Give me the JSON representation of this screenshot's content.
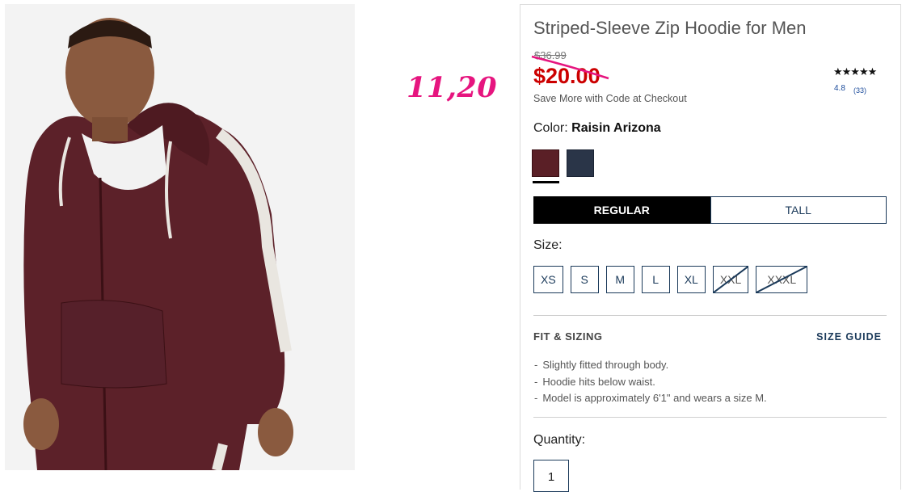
{
  "annotation": {
    "text": "11,20"
  },
  "product": {
    "title": "Striped-Sleeve Zip Hoodie for Men",
    "original_price": "$36.99",
    "sale_price": "$20.00",
    "promo": "Save More with Code at Checkout",
    "rating": {
      "stars": "★★★★★",
      "score": "4.8",
      "count": "(33)"
    }
  },
  "color": {
    "label": "Color:",
    "selected": "Raisin Arizona",
    "swatches": [
      {
        "name": "Raisin Arizona",
        "hex": "#5a1f26",
        "selected": true
      },
      {
        "name": "navy",
        "hex": "#2a3548",
        "selected": false
      }
    ]
  },
  "fit": {
    "options": [
      {
        "label": "REGULAR",
        "active": true
      },
      {
        "label": "TALL",
        "active": false
      }
    ]
  },
  "size": {
    "label": "Size:",
    "options": [
      {
        "label": "XS",
        "available": true
      },
      {
        "label": "S",
        "available": true
      },
      {
        "label": "M",
        "available": true
      },
      {
        "label": "L",
        "available": true
      },
      {
        "label": "XL",
        "available": true
      },
      {
        "label": "XXL",
        "available": false
      },
      {
        "label": "XXXL",
        "available": false
      }
    ]
  },
  "fit_sizing": {
    "heading": "FIT & SIZING",
    "guide_link": "SIZE GUIDE",
    "bullets": [
      "Slightly fitted through body.",
      "Hoodie hits below waist.",
      "Model is approximately 6'1\" and wears a size M."
    ]
  },
  "quantity": {
    "label": "Quantity:",
    "value": "1"
  },
  "colors": {
    "price_red": "#cc0000",
    "navy": "#1b3a5a",
    "annotation_pink": "#e6157f"
  }
}
